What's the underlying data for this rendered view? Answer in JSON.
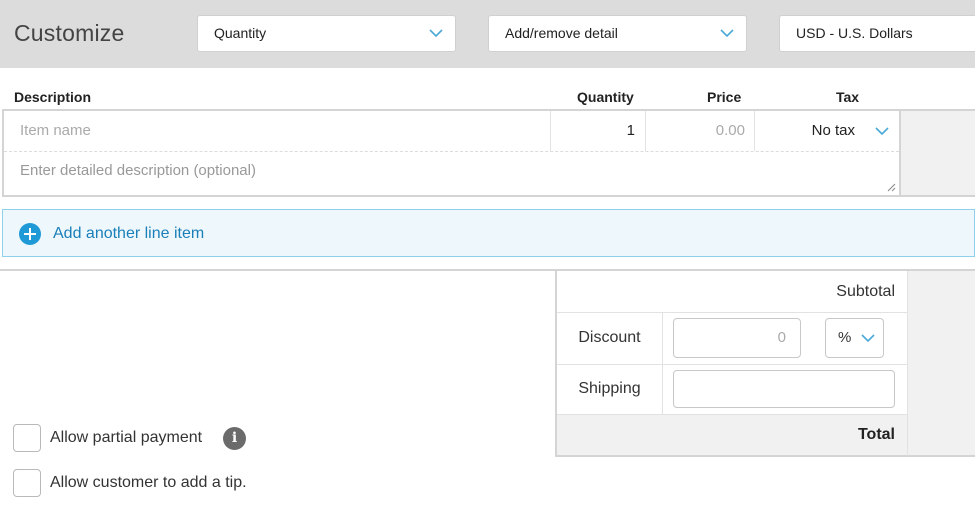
{
  "toolbar": {
    "title": "Customize",
    "column_select": "Quantity",
    "detail_select": "Add/remove detail",
    "currency_select": "USD - U.S. Dollars"
  },
  "columns": {
    "description": "Description",
    "quantity": "Quantity",
    "price": "Price",
    "tax": "Tax"
  },
  "line_item": {
    "name_placeholder": "Item name",
    "quantity": "1",
    "price_placeholder": "0.00",
    "tax": "No tax",
    "description_placeholder": "Enter detailed description (optional)"
  },
  "add_line": {
    "label": "Add another line item",
    "icon": "plus-circle-icon"
  },
  "totals": {
    "subtotal_label": "Subtotal",
    "discount_label": "Discount",
    "discount_placeholder": "0",
    "discount_unit": "%",
    "shipping_label": "Shipping",
    "total_label": "Total"
  },
  "options": {
    "partial_payment_label": "Allow partial payment",
    "info_icon": "info-icon",
    "tip_label": "Allow customer to add a tip."
  },
  "colors": {
    "accent": "#1f9ad6",
    "link": "#1a7fb8",
    "toolbar_bg": "#dcdcdc",
    "add_line_bg": "#eef8fc",
    "add_line_border": "#8fd1eb"
  }
}
